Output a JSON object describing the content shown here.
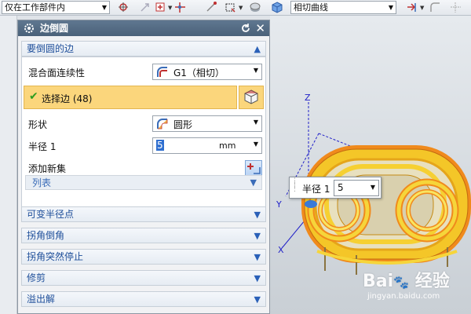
{
  "toolbar": {
    "filter_select": "仅在工作部件内",
    "curve_rule_select": "相切曲线"
  },
  "dialog": {
    "title": "边倒圆",
    "edges_group": {
      "title": "要倒圆的边",
      "continuity_label": "混合面连续性",
      "continuity_value": "G1（相切）",
      "select_edge_label": "选择边 (48)",
      "shape_label": "形状",
      "shape_value": "圆形",
      "radius_label": "半径 1",
      "radius_value": "5",
      "radius_unit": "mm",
      "add_set_label": "添加新集",
      "list_label": "列表"
    },
    "collapsed_groups": [
      {
        "label": "可变半径点"
      },
      {
        "label": "拐角倒角"
      },
      {
        "label": "拐角突然停止"
      },
      {
        "label": "修剪"
      },
      {
        "label": "溢出解"
      }
    ]
  },
  "viewport": {
    "axis_z": "Z",
    "axis_y": "Y",
    "axis_x": "X",
    "radius_popup_label": "半径 1",
    "radius_popup_value": "5"
  },
  "watermark": {
    "logo_text": "Bai 经验",
    "url": "jingyan.baidu.com"
  },
  "icons": [
    "chevron-up-icon",
    "chevron-down-icon",
    "gear-icon",
    "reset-icon",
    "close-icon",
    "check-icon",
    "cube-select-icon",
    "continuity-icon",
    "shape-icon",
    "add-set-icon"
  ],
  "colors": {
    "title_bar": "#5f7790",
    "selection_highlight": "#fbd67c",
    "group_title": "#1f4f9a",
    "model_yellow": "#f2cf2a",
    "model_orange": "#f08a1c"
  }
}
